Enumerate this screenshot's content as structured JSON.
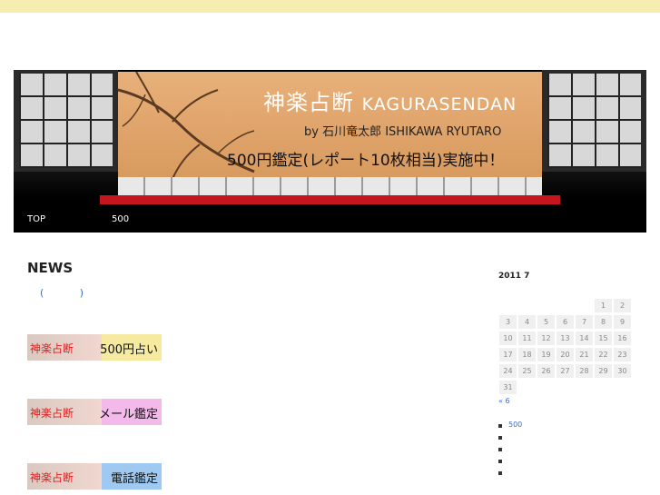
{
  "banner": {
    "title_jp": "神楽占断",
    "title_en": "KAGURASENDAN",
    "by_line": "by 石川竜太郎 ISHIKAWA RYUTARO",
    "promo": "500円鑑定(レポート10枚相当)実施中！"
  },
  "nav": {
    "items": [
      "TOP",
      "500"
    ]
  },
  "main": {
    "news_title": "NEWS",
    "news_paren": "( )",
    "promos": [
      {
        "logo_text": "神楽占断",
        "label": "500円占い",
        "color": "#f5eaa0"
      },
      {
        "logo_text": "神楽占断",
        "label": "メール鑑定",
        "color": "#f3b9ea"
      },
      {
        "logo_text": "神楽占断",
        "label": "電話鑑定",
        "color": "#9fc9f0"
      }
    ]
  },
  "sidebar": {
    "calendar_title": "2011  7",
    "calendar_days": [
      "",
      "",
      "",
      "",
      "",
      "1",
      "2",
      "3",
      "4",
      "5",
      "6",
      "7",
      "8",
      "9",
      "10",
      "11",
      "12",
      "13",
      "14",
      "15",
      "16",
      "17",
      "18",
      "19",
      "20",
      "21",
      "22",
      "23",
      "24",
      "25",
      "26",
      "27",
      "28",
      "29",
      "30",
      "31"
    ],
    "prev_link": "« 6",
    "list_items": [
      "500",
      "",
      "",
      "",
      ""
    ]
  },
  "colors": {
    "topbar": "#f6eeb0",
    "link": "#3a6cc8",
    "carpet": "#c4161c"
  }
}
